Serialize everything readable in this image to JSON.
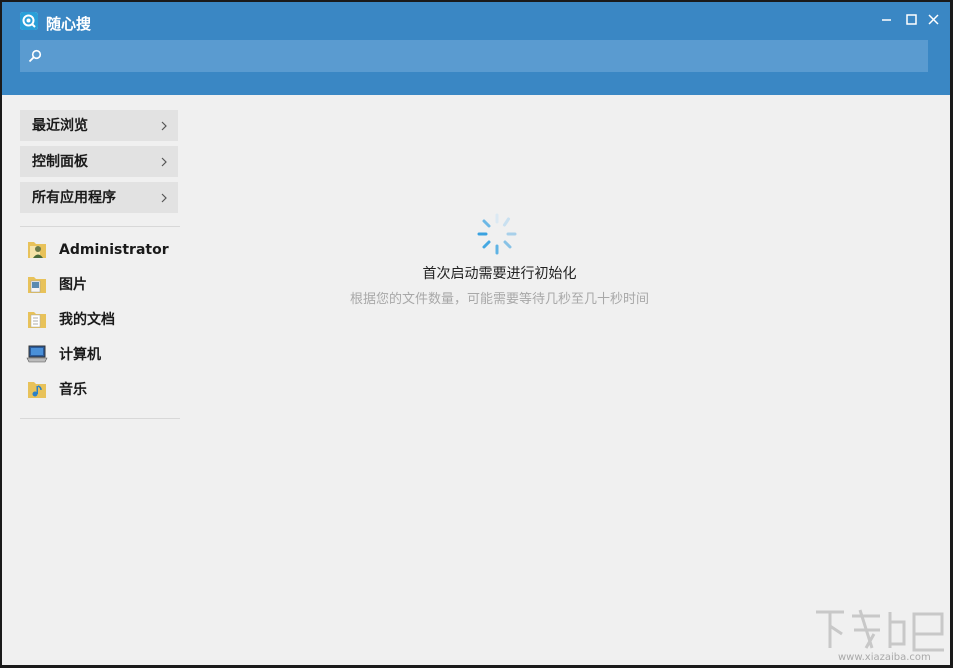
{
  "app": {
    "title": "随心搜",
    "icon": "search-app-icon",
    "accent": "#3a87c4"
  },
  "window_controls": [
    "minimize-icon",
    "maximize-icon",
    "close-icon"
  ],
  "search": {
    "value": "",
    "placeholder": ""
  },
  "sidebar": {
    "items": [
      {
        "label": "最近浏览"
      },
      {
        "label": "控制面板"
      },
      {
        "label": "所有应用程序"
      }
    ]
  },
  "places": [
    {
      "label": "Administrator",
      "icon": "user-folder-icon"
    },
    {
      "label": "图片",
      "icon": "pictures-folder-icon"
    },
    {
      "label": "我的文档",
      "icon": "documents-folder-icon"
    },
    {
      "label": "计算机",
      "icon": "computer-icon"
    },
    {
      "label": "音乐",
      "icon": "music-folder-icon"
    }
  ],
  "main": {
    "title": "首次启动需要进行初始化",
    "subtitle": "根据您的文件数量，可能需要等待几秒至几十秒时间"
  },
  "watermark": {
    "text": "www.xiazaiba.com"
  }
}
